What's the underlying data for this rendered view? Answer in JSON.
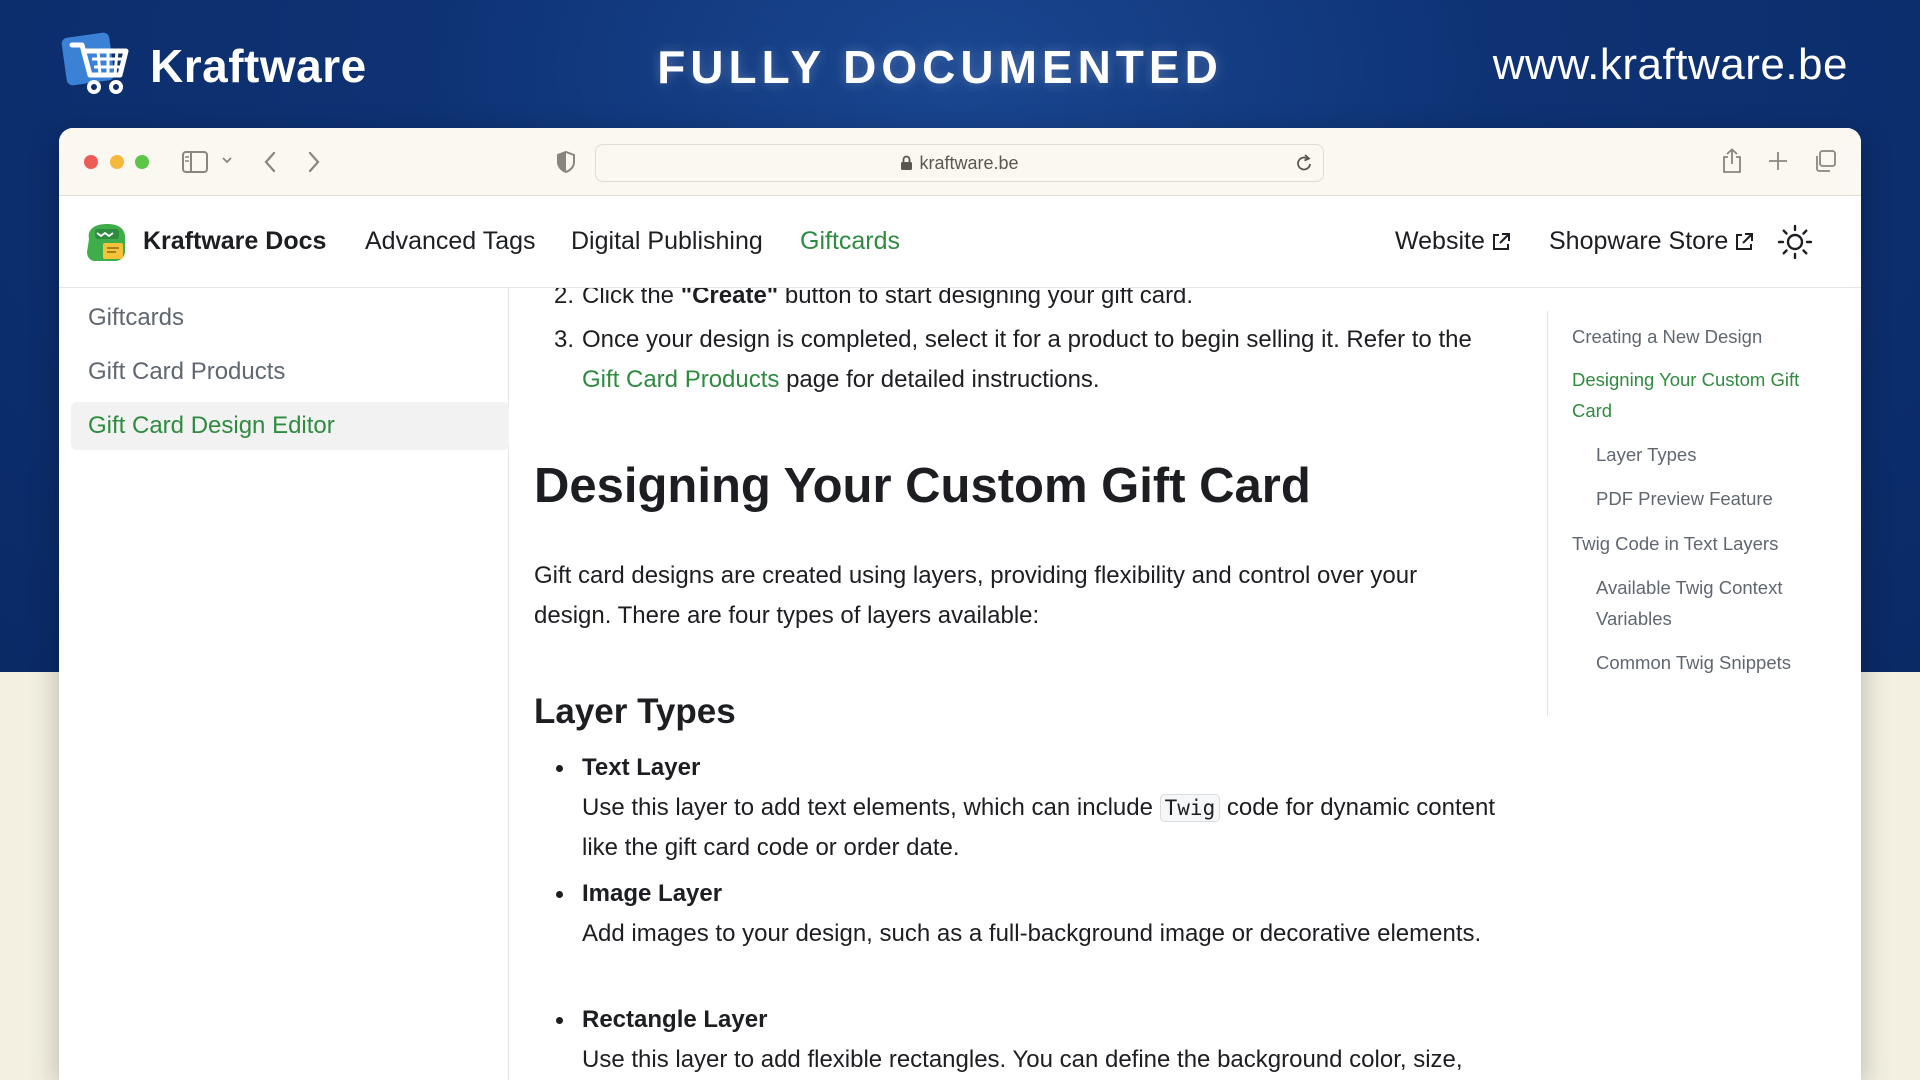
{
  "banner": {
    "brand_name": "Kraftware",
    "title": "FULLY DOCUMENTED",
    "url": "www.kraftware.be"
  },
  "browser": {
    "address": "kraftware.be"
  },
  "navbar": {
    "title": "Kraftware Docs",
    "links": [
      {
        "label": "Advanced Tags"
      },
      {
        "label": "Digital Publishing"
      },
      {
        "label": "Giftcards"
      }
    ],
    "right": [
      {
        "label": "Website"
      },
      {
        "label": "Shopware Store"
      }
    ]
  },
  "sidebar": {
    "items": [
      {
        "label": "Giftcards"
      },
      {
        "label": "Gift Card Products"
      },
      {
        "label": "Gift Card Design Editor"
      }
    ]
  },
  "content": {
    "step2": {
      "num": "2.",
      "before": "Click the ",
      "strong": "\"Create\"",
      "after": " button to start designing your gift card."
    },
    "step3": {
      "num": "3.",
      "line1": "Once your design is completed, select it for a product to begin selling it. Refer to the",
      "link": "Gift Card Products",
      "after": " page for detailed instructions."
    },
    "heading": "Designing Your Custom Gift Card",
    "intro": "Gift card designs are created using layers, providing flexibility and control over your design. There are four types of layers available:",
    "subheading": "Layer Types",
    "bullets": [
      {
        "title": "Text Layer",
        "before": "Use this layer to add text elements, which can include ",
        "code": "Twig",
        "after": " code for dynamic content like the gift card code or order date."
      },
      {
        "title": "Image Layer",
        "text": "Add images to your design, such as a full-background image or decorative elements."
      },
      {
        "title": "Rectangle Layer",
        "text": "Use this layer to add flexible rectangles. You can define the background color, size,"
      }
    ]
  },
  "toc": {
    "items": [
      {
        "label": "Creating a New Design"
      },
      {
        "label": "Designing Your Custom Gift Card"
      },
      {
        "label": "Layer Types"
      },
      {
        "label": "PDF Preview Feature"
      },
      {
        "label": "Twig Code in Text Layers"
      },
      {
        "label": "Available Twig Context Variables"
      },
      {
        "label": "Common Twig Snippets"
      }
    ]
  },
  "colors": {
    "banner_blue": "#0e3274",
    "accent_green": "#2e8b3f",
    "page_cream": "#f3f0e2"
  }
}
